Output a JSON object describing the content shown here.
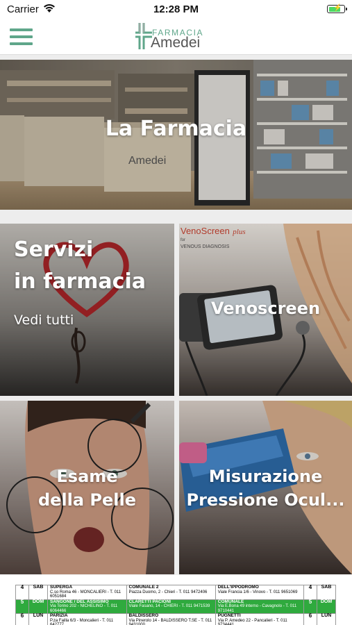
{
  "status_bar": {
    "carrier": "Carrier",
    "time": "12:28 PM"
  },
  "header": {
    "logo_line1": "FARMACIA",
    "logo_line2": "Amedei"
  },
  "banner": {
    "title": "La Farmacia"
  },
  "tiles": [
    {
      "title_line1": "Servizi",
      "title_line2": "in farmacia",
      "link": "Vedi tutti"
    },
    {
      "title": "Venoscreen",
      "brand": "VenoScreen",
      "brand_suffix": "plus",
      "brand_sub": "VENOUS DIAGNOSIS",
      "brand_for": "for"
    },
    {
      "title_line1": "Esame",
      "title_line2": "della Pelle"
    },
    {
      "title_line1": "Misurazione",
      "title_line2": "Pressione Ocul..."
    }
  ],
  "calendar": {
    "rows": [
      {
        "num": "4",
        "dow": "SAB",
        "c1_name": "SUPERGA",
        "c1_addr": "C.so Roma 46 - MONCALIERI - T. 011 6051684",
        "c2_name": "COMUNALE 2",
        "c2_addr": "Piazza Duomo, 2 - Chieri - T. 011 9472406",
        "c3_name": "DELL'IPPODROMO",
        "c3_addr": "Viale Francia 1/6 - Vinovo - T. 011 9651069",
        "num_r": "4",
        "dow_r": "SAB",
        "green": false
      },
      {
        "num": "5",
        "dow": "DOM",
        "c1_name": "SANGONE / DEL ASSISIMO",
        "c1_addr": "Via Torino 202 - NICHELINO - T. 011 6064466",
        "c2_name": "CLARETTI PACIONI",
        "c2_addr": "Viale Fasano, 14 - CHIERI - T. 011 9471539",
        "c3_name": "COMUNALE",
        "c3_addr": "Via E.Bona 49 interno - Cavagnolo - T. 011 9710441",
        "num_r": "5",
        "dow_r": "DOM",
        "green": true
      },
      {
        "num": "6",
        "dow": "LUN",
        "c1_name": "PARIZIA",
        "c1_addr": "P.za Failla 6/3 - Moncalieri - T. 011 642777",
        "c2_name": "BALDISSERO",
        "c2_addr": "Via Pinerolo 14 - BALDISSERO T.SE - T. 011 9431000",
        "c3_name": "PUGNETTI",
        "c3_addr": "Via P. Amedeo 22 - Pancalieri - T. 011 9734441",
        "num_r": "6",
        "dow_r": "LUN",
        "green": false
      }
    ]
  }
}
